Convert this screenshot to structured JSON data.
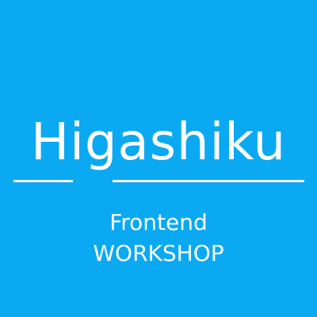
{
  "brand": {
    "title": "Higashiku",
    "subtitle_line1": "Frontend",
    "subtitle_line2": "WORKSHOP",
    "background_color": "#0aa9f2",
    "text_color": "#ffffff"
  }
}
